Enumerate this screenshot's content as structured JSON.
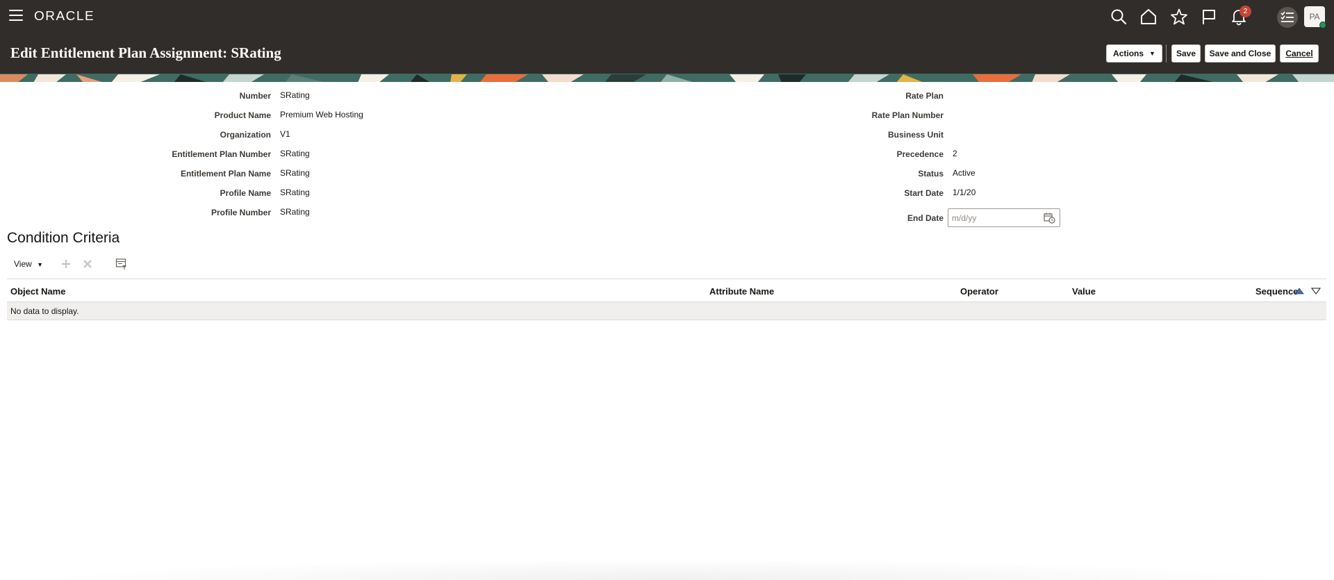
{
  "header": {
    "brand": "ORACLE",
    "notification_count": "2",
    "avatar_initials": "PA"
  },
  "title_bar": {
    "title": "Edit Entitlement Plan Assignment: SRating",
    "actions_label": "Actions",
    "save_label": "Save",
    "save_close_label": "Save and Close",
    "cancel_label": "Cancel"
  },
  "form": {
    "left": [
      {
        "label": "Number",
        "value": "SRating"
      },
      {
        "label": "Product Name",
        "value": "Premium Web Hosting"
      },
      {
        "label": "Organization",
        "value": "V1"
      },
      {
        "label": "Entitlement Plan Number",
        "value": "SRating"
      },
      {
        "label": "Entitlement Plan Name",
        "value": "SRating"
      },
      {
        "label": "Profile Name",
        "value": "SRating"
      },
      {
        "label": "Profile Number",
        "value": "SRating"
      }
    ],
    "right": [
      {
        "label": "Rate Plan",
        "value": ""
      },
      {
        "label": "Rate Plan Number",
        "value": ""
      },
      {
        "label": "Business Unit",
        "value": ""
      },
      {
        "label": "Precedence",
        "value": "2"
      },
      {
        "label": "Status",
        "value": "Active"
      },
      {
        "label": "Start Date",
        "value": "1/1/20"
      }
    ],
    "end_date": {
      "label": "End Date",
      "value": "",
      "placeholder": "m/d/yy"
    }
  },
  "condition_criteria": {
    "title": "Condition Criteria",
    "view_label": "View",
    "columns": [
      "Object Name",
      "Attribute Name",
      "Operator",
      "Value",
      "Sequence"
    ],
    "empty_message": "No data to display."
  },
  "colors": {
    "header_bg": "#312d2a",
    "badge": "#c74634",
    "presence": "#1e9a52"
  }
}
